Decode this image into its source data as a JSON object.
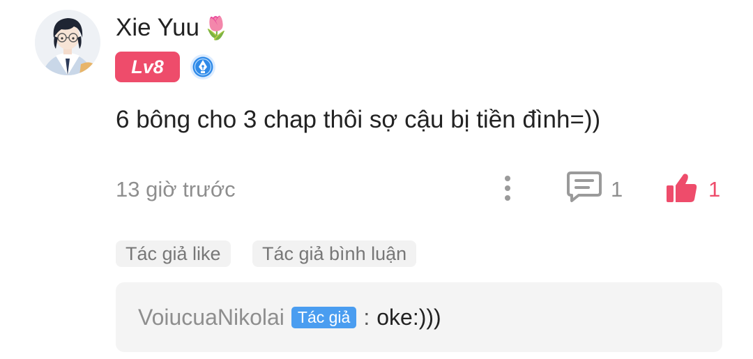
{
  "user": {
    "name": "Xie Yuu",
    "name_emoji": "🌷",
    "level": "Lv8",
    "level_color": "#ee4c6b"
  },
  "comment": {
    "text": "6 bông cho 3 chap thôi sợ cậu bị tiền đình=))",
    "timestamp": "13 giờ trước",
    "reply_count": "1",
    "like_count": "1",
    "like_color": "#ee4c6b"
  },
  "tags": {
    "author_like": "Tác giả like",
    "author_reply": "Tác giả bình luận"
  },
  "reply": {
    "author": "VoiucuaNikolai",
    "badge": "Tác giả",
    "badge_color": "#4a9df0",
    "separator": ":",
    "text": "oke:)))"
  },
  "icons": [
    "avatar",
    "pen-badge-icon",
    "more-vertical-icon",
    "comment-icon",
    "thumbs-up-icon"
  ]
}
